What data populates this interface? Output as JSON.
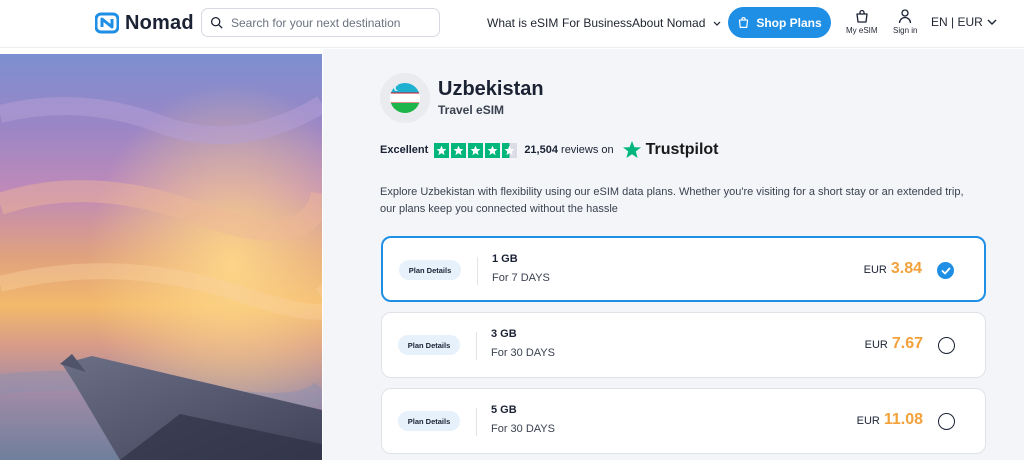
{
  "header": {
    "brand": "Nomad",
    "search_placeholder": "Search for your next destination",
    "nav": {
      "what_is_esim": "What is eSIM",
      "for_business": "For Business",
      "about": "About Nomad"
    },
    "shop_plans": "Shop Plans",
    "my_esim": "My eSIM",
    "sign_in": "Sign in",
    "language_currency": "EN | EUR",
    "accent_color": "#1f8fe6"
  },
  "destination": {
    "country": "Uzbekistan",
    "subtitle": "Travel eSIM",
    "description": "Explore Uzbekistan with flexibility using our eSIM data plans. Whether you're visiting for a short stay or an extended trip, our plans keep you connected without the hassle"
  },
  "rating": {
    "label": "Excellent",
    "stars": 4.5,
    "review_count": "21,504",
    "reviews_suffix": "reviews on",
    "provider": "Trustpilot"
  },
  "plans": [
    {
      "details_label": "Plan Details",
      "data": "1 GB",
      "duration": "For 7 DAYS",
      "currency": "EUR",
      "price": "3.84",
      "selected": true
    },
    {
      "details_label": "Plan Details",
      "data": "3 GB",
      "duration": "For 30 DAYS",
      "currency": "EUR",
      "price": "7.67",
      "selected": false
    },
    {
      "details_label": "Plan Details",
      "data": "5 GB",
      "duration": "For 30 DAYS",
      "currency": "EUR",
      "price": "11.08",
      "selected": false
    }
  ],
  "colors": {
    "price": "#f3a13b",
    "trustpilot_green": "#00b67a"
  }
}
